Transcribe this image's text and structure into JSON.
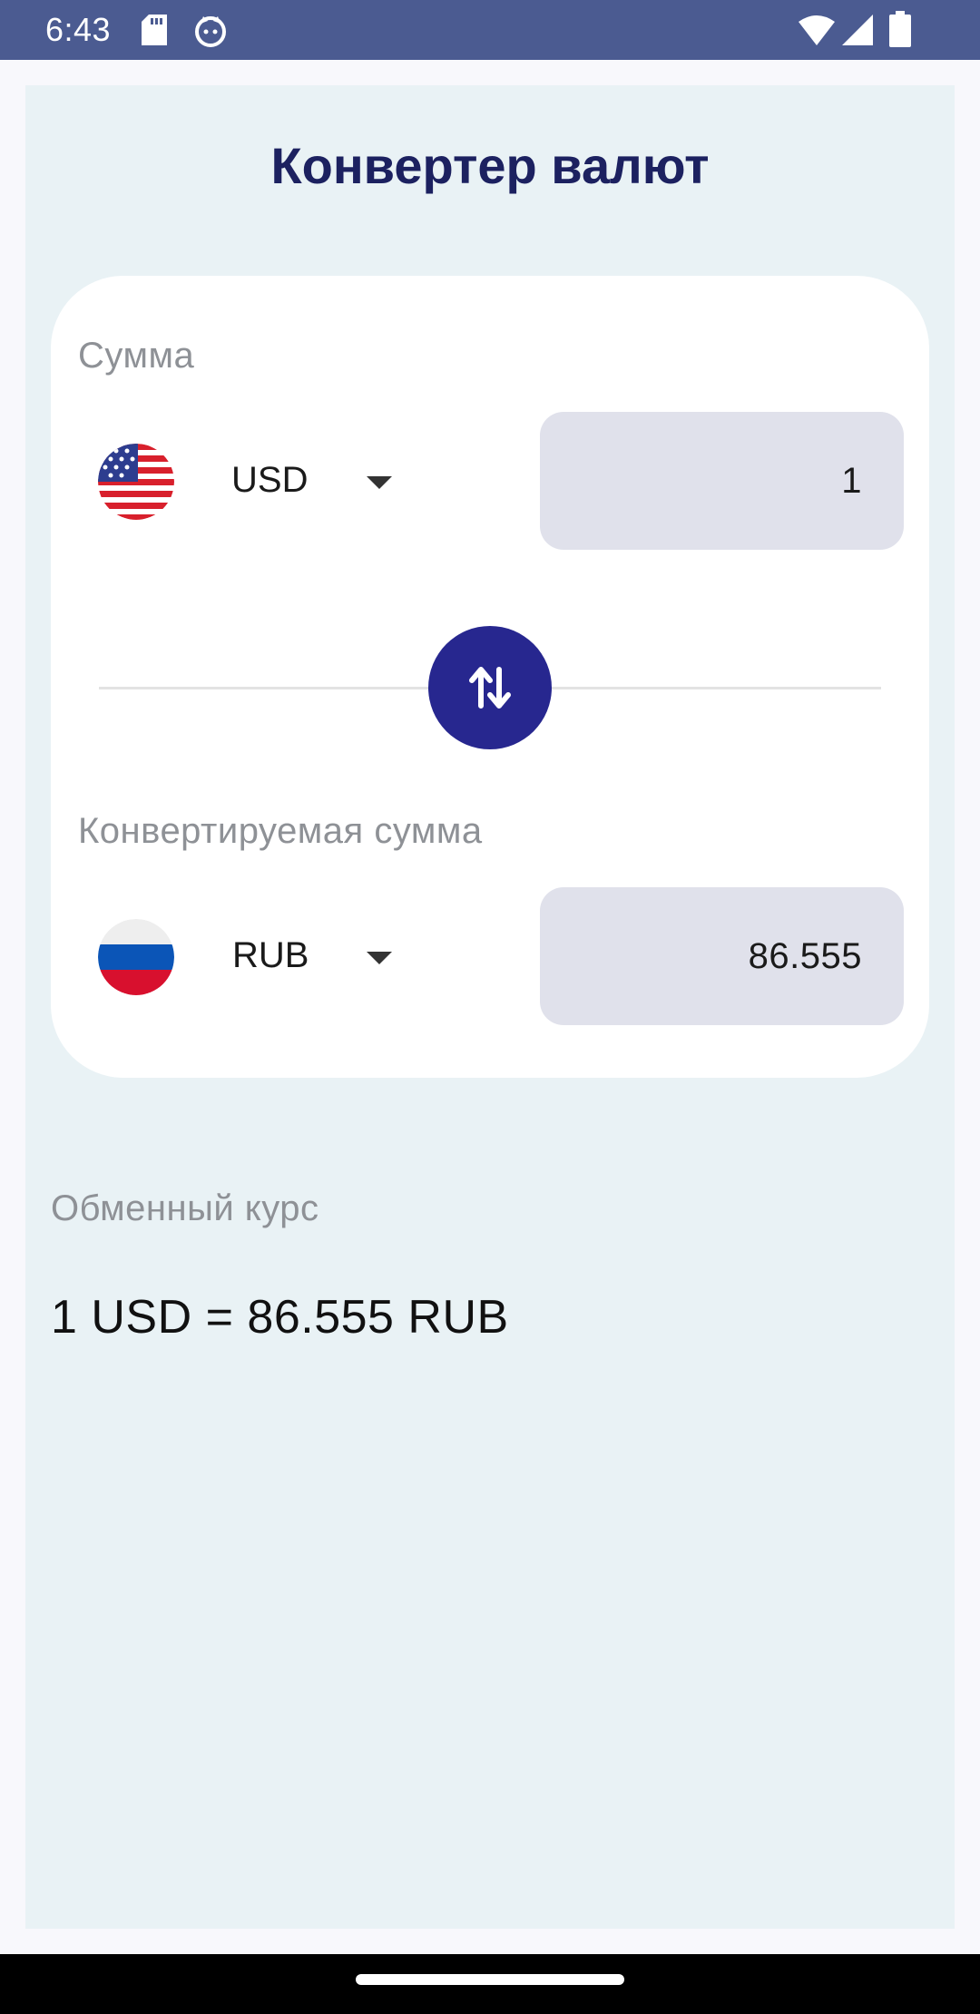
{
  "status_bar": {
    "time": "6:43",
    "icons": [
      "sd-card-icon",
      "cat-icon",
      "wifi-icon",
      "signal-icon",
      "battery-icon"
    ]
  },
  "title": "Конвертер валют",
  "converter": {
    "amount_label": "Сумма",
    "from": {
      "code": "USD",
      "flag": "us-flag-icon",
      "amount": "1"
    },
    "swap_icon": "swap-vertical-icon",
    "converted_label": "Конвертируемая сумма",
    "to": {
      "code": "RUB",
      "flag": "ru-flag-icon",
      "amount": "86.555"
    }
  },
  "rate": {
    "label": "Обменный курс",
    "value": "1 USD = 86.555 RUB"
  },
  "colors": {
    "status_bar": "#4b5b91",
    "panel_background": "#e9f2f5",
    "title": "#1c2160",
    "swap_button": "#27278f",
    "field_background": "#e0e1eb"
  }
}
